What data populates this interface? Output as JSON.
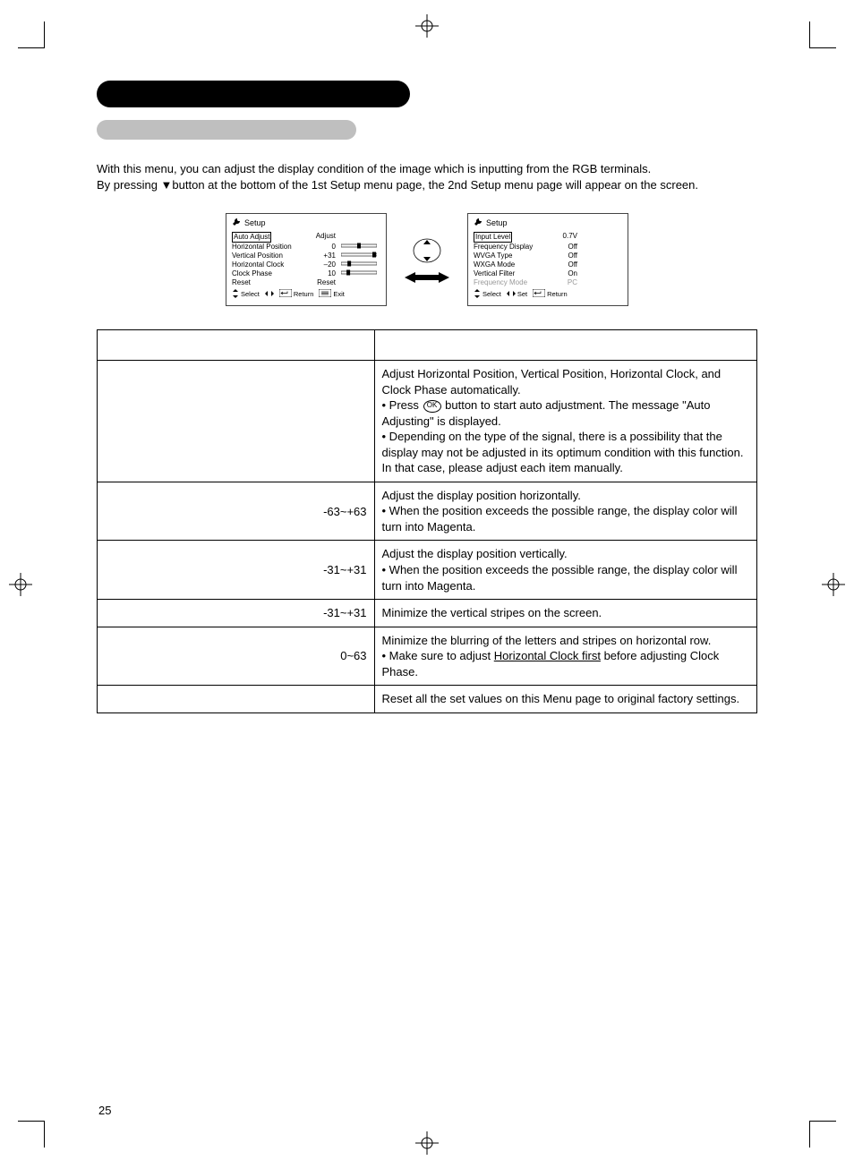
{
  "intro": {
    "p1": "With this menu, you can adjust the display condition of the image which is inputting from the RGB terminals.",
    "p2a": "By pressing ",
    "p2b": "▼",
    "p2c": "button at the bottom of the 1st Setup menu page, the 2nd Setup menu page will appear on the screen."
  },
  "osd1": {
    "title": "Setup",
    "rows": [
      {
        "label": "Auto Adjust",
        "value": "Adjust",
        "hl": true
      },
      {
        "label": "Horizontal Position",
        "value": "0",
        "slider": 50
      },
      {
        "label": "Vertical Position",
        "value": "+31",
        "slider": 100
      },
      {
        "label": "Horizontal Clock",
        "value": "–20",
        "slider": 18
      },
      {
        "label": "Clock Phase",
        "value": "10",
        "slider": 15
      },
      {
        "label": "Reset",
        "value": "Reset"
      }
    ],
    "footer": {
      "select": "Select",
      "return": "Return",
      "exit": "Exit"
    }
  },
  "osd2": {
    "title": "Setup",
    "rows": [
      {
        "label": "Input Level",
        "value": "0.7V",
        "hl": true
      },
      {
        "label": "Frequency Display",
        "value": "Off"
      },
      {
        "label": "WVGA Type",
        "value": "Off"
      },
      {
        "label": "WXGA Mode",
        "value": "Off"
      },
      {
        "label": "Vertical Filter",
        "value": "On"
      },
      {
        "label": "Frequency Mode",
        "value": "PC",
        "dim": true
      }
    ],
    "footer": {
      "select": "Select",
      "set": "Set",
      "return": "Return"
    }
  },
  "table": {
    "rows": [
      {
        "range": "",
        "desc_pre": "Adjust Horizontal Position, Vertical Position, Horizontal Clock, and Clock Phase automatically.",
        "bullets": [
          {
            "pre": "Press ",
            "ok": true,
            "post": " button to start auto adjustment. The message \"Auto Adjusting\" is displayed."
          },
          {
            "text": "Depending on the type of the signal, there is a possibility that the display may not be adjusted in its optimum condition with this function.  In that case, please adjust each item manually."
          }
        ]
      },
      {
        "range": "-63~+63",
        "desc_pre": "Adjust the display position horizontally.",
        "bullets": [
          {
            "text": "When the position exceeds the possible range, the display color will turn into Magenta."
          }
        ]
      },
      {
        "range": "-31~+31",
        "desc_pre": "Adjust the display position vertically.",
        "bullets": [
          {
            "text": "When the position exceeds the possible range, the display color will turn into Magenta."
          }
        ]
      },
      {
        "range": "-31~+31",
        "desc_pre": "Minimize the vertical stripes on the screen.",
        "bullets": []
      },
      {
        "range": "0~63",
        "desc_pre": "Minimize the blurring of the letters and stripes on horizontal row.",
        "bullets": [
          {
            "pre": "Make sure to adjust ",
            "under": "Horizontal Clock first",
            "post": " before adjusting Clock Phase."
          }
        ]
      },
      {
        "range": "",
        "desc_pre": "Reset all the set values on this Menu page to original factory settings.",
        "bullets": []
      }
    ]
  },
  "pagenum": "25"
}
